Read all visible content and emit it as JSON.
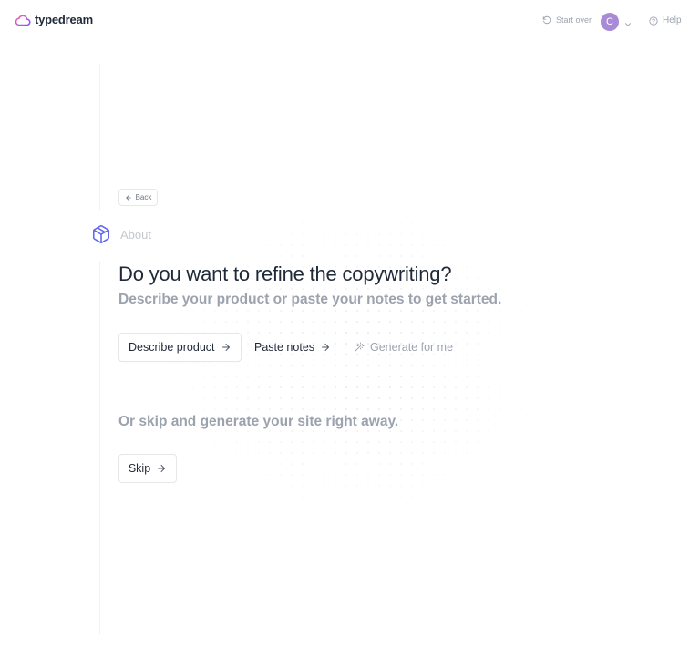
{
  "header": {
    "logo_text": "typedream",
    "start_over_label": "Start over",
    "avatar_letter": "C",
    "help_label": "Help"
  },
  "step": {
    "back_label": "Back",
    "section_label": "About"
  },
  "main": {
    "title": "Do you want to refine the copywriting?",
    "subtitle": "Describe your product or paste your notes to get started.",
    "options": [
      {
        "label": "Describe product"
      },
      {
        "label": "Paste notes"
      },
      {
        "label": "Generate for me"
      }
    ],
    "skip_prompt": "Or skip and generate your site right away.",
    "skip_label": "Skip"
  },
  "colors": {
    "brand_gradient_start": "#ff5fa2",
    "brand_gradient_end": "#7c5cff",
    "avatar_bg": "#a98ad6",
    "icon_accent": "#6366f1",
    "muted_text": "#9ca3af"
  },
  "icons": {
    "logo": "cloud-logo-icon",
    "start_over": "rotate-ccw-icon",
    "avatar_menu": "chevron-down-icon",
    "help": "help-circle-icon",
    "back": "arrow-left-icon",
    "section": "box-icon",
    "option_arrow": "arrow-right-icon",
    "generate": "magic-wand-icon"
  }
}
